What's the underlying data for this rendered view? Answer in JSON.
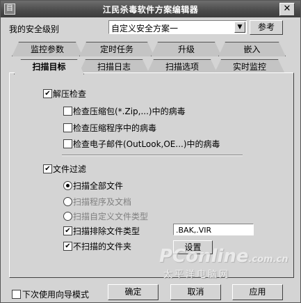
{
  "window": {
    "title": "江民杀毒软件方案编辑器",
    "close_label": "✕",
    "sysmenu_label": "目"
  },
  "security": {
    "label": "我的安全级别",
    "selected": "自定义安全方案一",
    "ref_button": "参考"
  },
  "tabs_back": [
    "监控参数",
    "定时任务",
    "升级",
    "嵌入"
  ],
  "tabs_front": [
    "扫描目标",
    "扫描日志",
    "扫描选项",
    "实时监控"
  ],
  "options": {
    "decompress": {
      "label": "解压检查",
      "checked": true
    },
    "decompress_items": [
      {
        "label": "检查压缩包(*.Zip,...)中的病毒",
        "checked": false
      },
      {
        "label": "检查压缩程序中的病毒",
        "checked": false
      },
      {
        "label": "检查电子邮件(OutLook,OE...)中的病毒",
        "checked": false
      }
    ],
    "filter": {
      "label": "文件过滤",
      "checked": true
    },
    "radio_items": [
      {
        "label": "扫描全部文件",
        "selected": true
      },
      {
        "label": "扫描程序及文档",
        "selected": false
      },
      {
        "label": "扫描自定义文件类型",
        "selected": false
      }
    ],
    "exclude_types": {
      "label": "扫描排除文件类型",
      "checked": true,
      "value": ".BAK,.VIR"
    },
    "skip_folders": {
      "label": "不扫描的文件夹",
      "checked": true,
      "button": "设置"
    }
  },
  "footer": {
    "wizard_label": "下次使用向导模式",
    "wizard_checked": false,
    "ok": "确定",
    "cancel": "取消",
    "apply": "应用"
  },
  "watermark": {
    "main": "PConline",
    "domain": ".com.cn",
    "sub": "太平洋电脑网"
  }
}
